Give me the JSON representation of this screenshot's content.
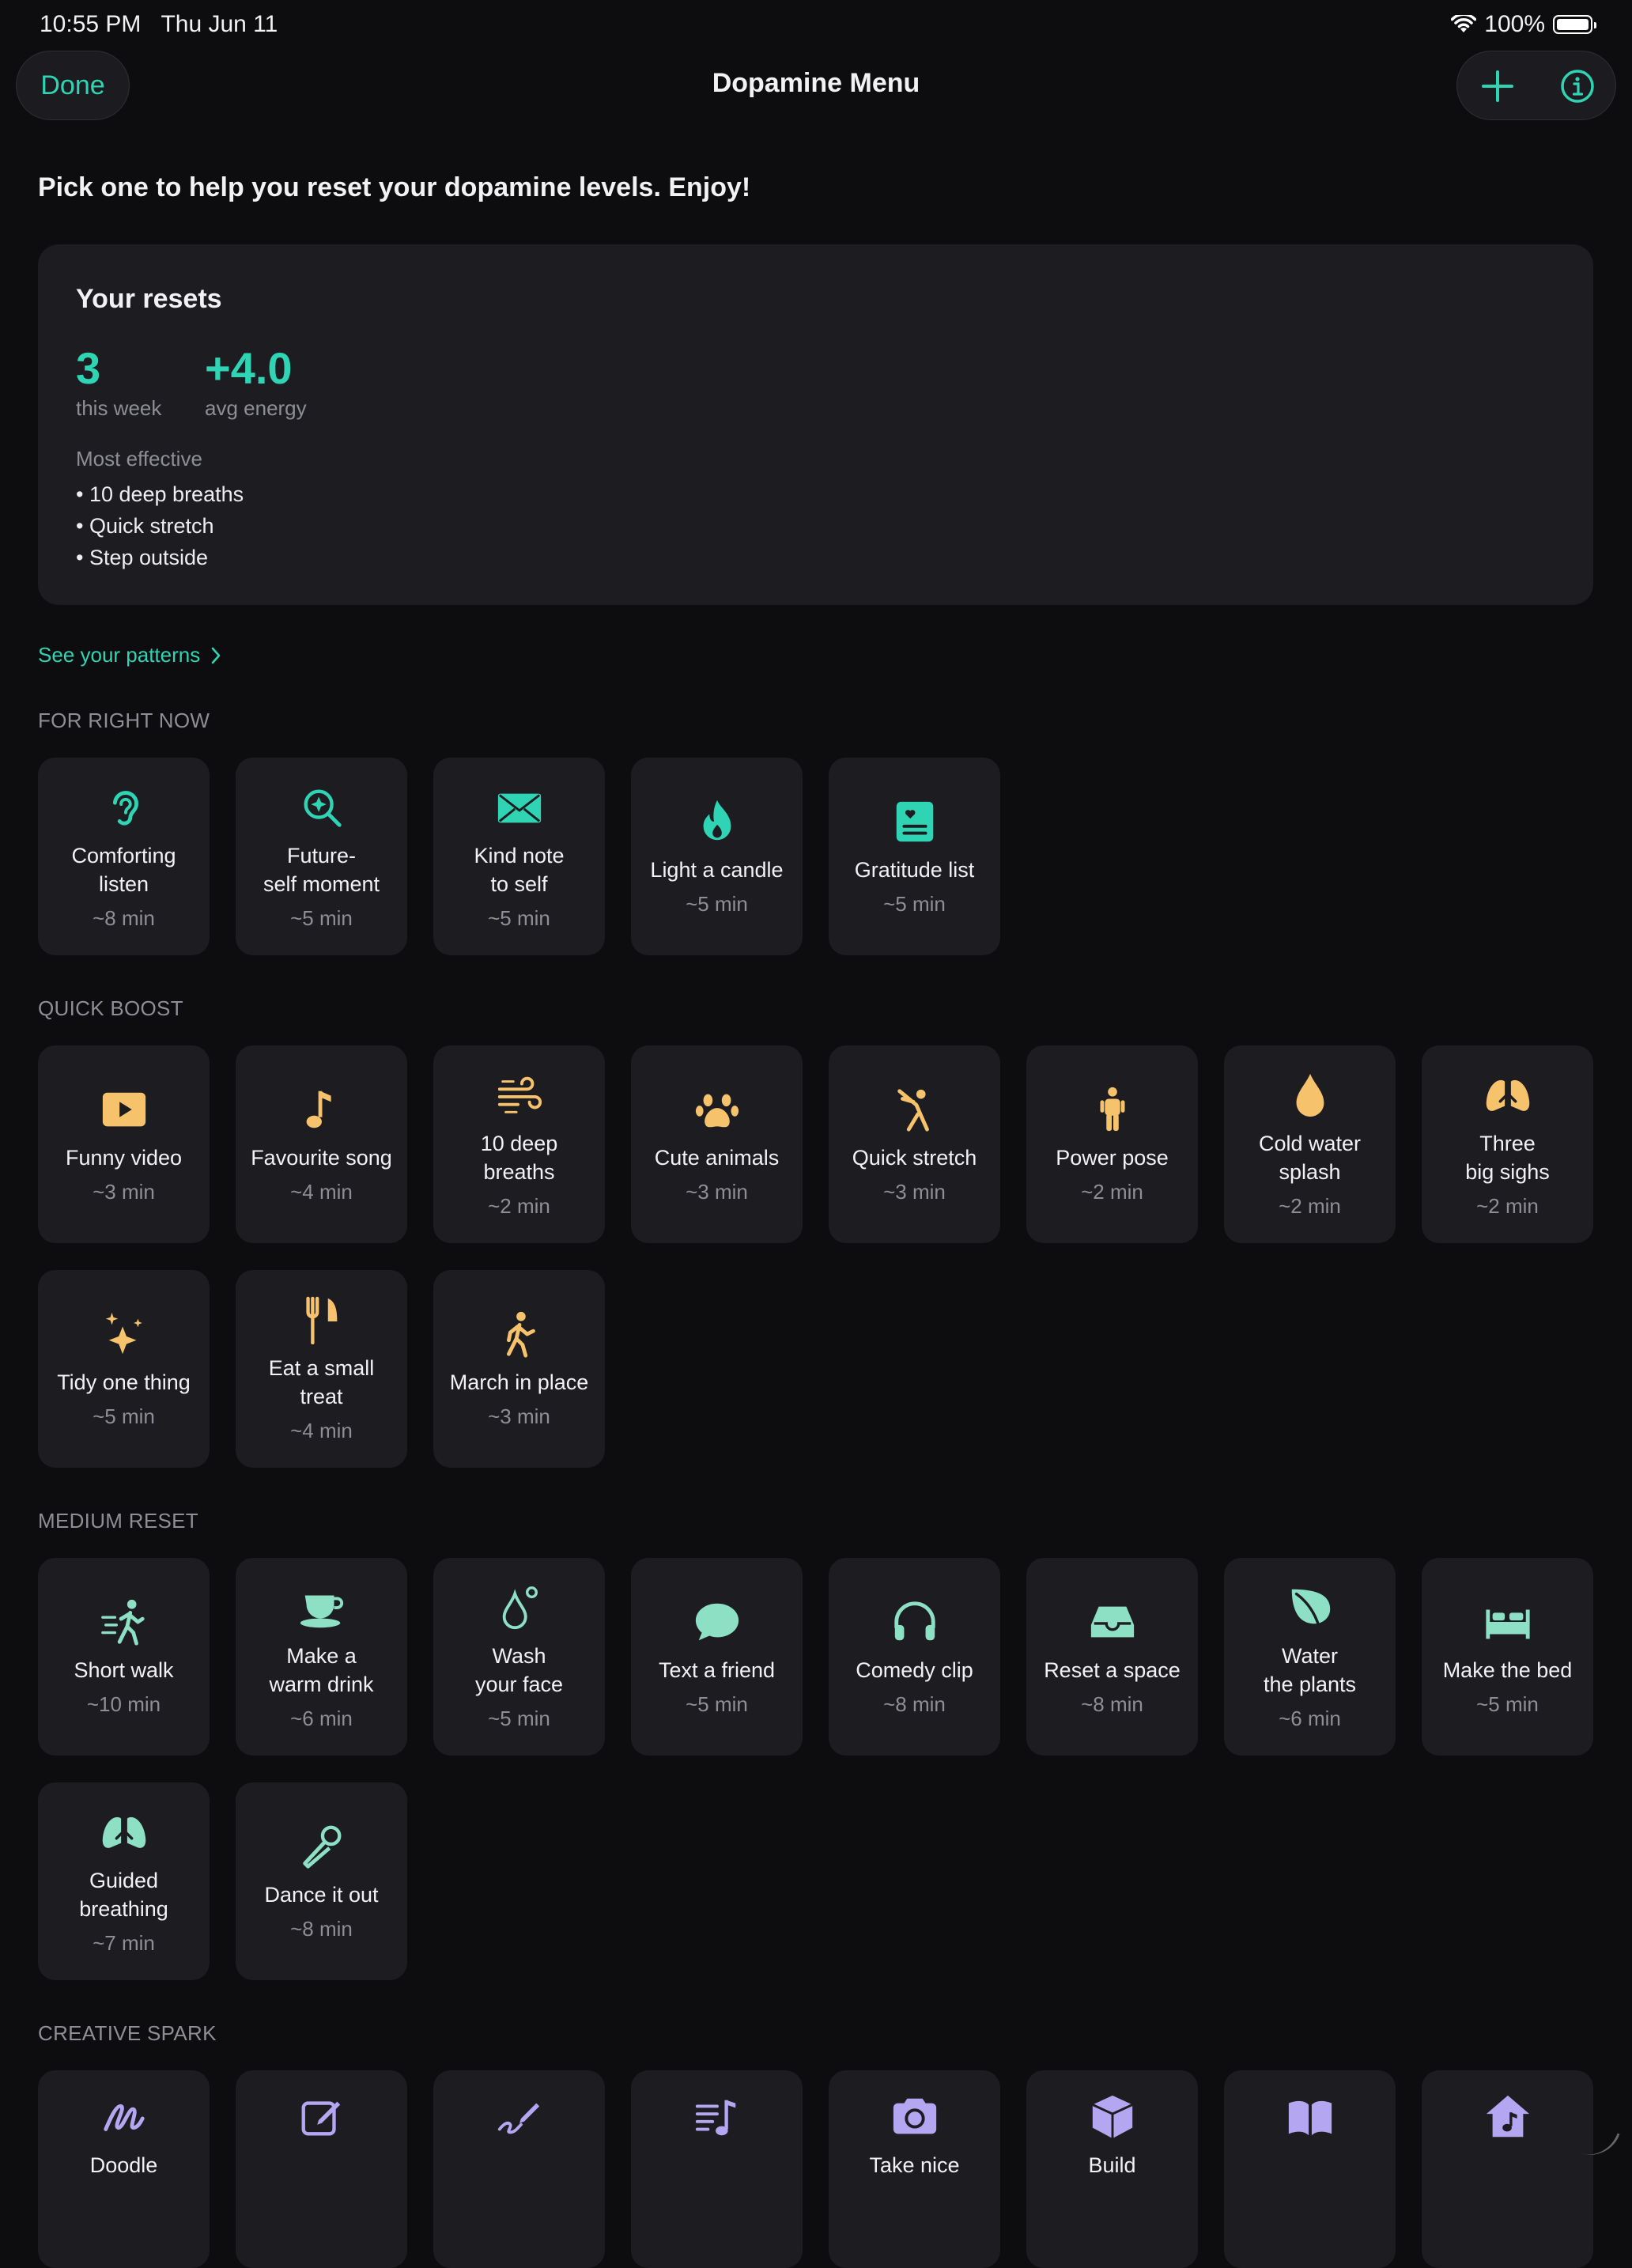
{
  "status": {
    "time": "10:55 PM",
    "date": "Thu Jun 11",
    "battery": "100%"
  },
  "nav": {
    "done": "Done",
    "title": "Dopamine Menu",
    "icons": [
      "plus-icon",
      "info-icon"
    ]
  },
  "subtitle": "Pick one to help you reset your dopamine levels. Enjoy!",
  "stats": {
    "title": "Your resets",
    "week_count": "3",
    "week_label": "this week",
    "energy": "+4.0",
    "energy_label": "avg energy",
    "most_effective_title": "Most effective",
    "most_effective": [
      "• 10 deep breaths",
      "• Quick stretch",
      "• Step outside"
    ]
  },
  "patterns_link": "See your patterns",
  "colors": {
    "accent": "#2fd4b4",
    "amber": "#f6c26b",
    "mint": "#8de0c4",
    "lavender": "#b5a6f2",
    "card": "#1c1c21",
    "background": "#0d0d0f"
  },
  "sections": [
    {
      "title": "FOR RIGHT NOW",
      "items": [
        {
          "label": "Comforting\nlisten",
          "duration": "~8 min",
          "icon": "ear-icon"
        },
        {
          "label": "Future-\nself moment",
          "duration": "~5 min",
          "icon": "sparkle-magnifier-icon"
        },
        {
          "label": "Kind note\nto self",
          "duration": "~5 min",
          "icon": "envelope-icon"
        },
        {
          "label": "Light a candle",
          "duration": "~5 min",
          "icon": "flame-icon"
        },
        {
          "label": "Gratitude list",
          "duration": "~5 min",
          "icon": "heart-list-icon"
        }
      ]
    },
    {
      "title": "QUICK BOOST",
      "items": [
        {
          "label": "Funny video",
          "duration": "~3 min",
          "icon": "play-icon"
        },
        {
          "label": "Favourite song",
          "duration": "~4 min",
          "icon": "music-note-icon"
        },
        {
          "label": "10 deep\nbreaths",
          "duration": "~2 min",
          "icon": "wind-icon"
        },
        {
          "label": "Cute animals",
          "duration": "~3 min",
          "icon": "paw-icon"
        },
        {
          "label": "Quick stretch",
          "duration": "~3 min",
          "icon": "stretch-icon"
        },
        {
          "label": "Power pose",
          "duration": "~2 min",
          "icon": "person-icon"
        },
        {
          "label": "Cold water\nsplash",
          "duration": "~2 min",
          "icon": "drop-icon"
        },
        {
          "label": "Three\nbig sighs",
          "duration": "~2 min",
          "icon": "lungs-icon"
        },
        {
          "label": "Tidy one thing",
          "duration": "~5 min",
          "icon": "sparkles-icon"
        },
        {
          "label": "Eat a small\ntreat",
          "duration": "~4 min",
          "icon": "fork-knife-icon"
        },
        {
          "label": "March in place",
          "duration": "~3 min",
          "icon": "walk-icon"
        }
      ]
    },
    {
      "title": "MEDIUM RESET",
      "items": [
        {
          "label": "Short walk",
          "duration": "~10 min",
          "icon": "fast-walk-icon"
        },
        {
          "label": "Make a\nwarm drink",
          "duration": "~6 min",
          "icon": "cup-icon"
        },
        {
          "label": "Wash\nyour face",
          "duration": "~5 min",
          "icon": "droplet-icon"
        },
        {
          "label": "Text a friend",
          "duration": "~5 min",
          "icon": "chat-bubble-icon"
        },
        {
          "label": "Comedy clip",
          "duration": "~8 min",
          "icon": "headphones-icon"
        },
        {
          "label": "Reset a space",
          "duration": "~8 min",
          "icon": "tray-icon"
        },
        {
          "label": "Water\nthe plants",
          "duration": "~6 min",
          "icon": "leaf-icon"
        },
        {
          "label": "Make the bed",
          "duration": "~5 min",
          "icon": "bed-icon"
        },
        {
          "label": "Guided\nbreathing",
          "duration": "~7 min",
          "icon": "lungs-icon"
        },
        {
          "label": "Dance it out",
          "duration": "~8 min",
          "icon": "microphone-icon"
        }
      ]
    },
    {
      "title": "CREATIVE SPARK",
      "items": [
        {
          "label": "Doodle",
          "duration": "",
          "icon": "scribble-icon"
        },
        {
          "label": "",
          "duration": "",
          "icon": "compose-icon"
        },
        {
          "label": "",
          "duration": "",
          "icon": "pencil-line-icon"
        },
        {
          "label": "",
          "duration": "",
          "icon": "music-list-icon"
        },
        {
          "label": "Take nice",
          "duration": "",
          "icon": "camera-icon"
        },
        {
          "label": "Build",
          "duration": "",
          "icon": "cube-icon"
        },
        {
          "label": "",
          "duration": "",
          "icon": "book-icon"
        },
        {
          "label": "",
          "duration": "",
          "icon": "music-house-icon"
        }
      ]
    }
  ]
}
